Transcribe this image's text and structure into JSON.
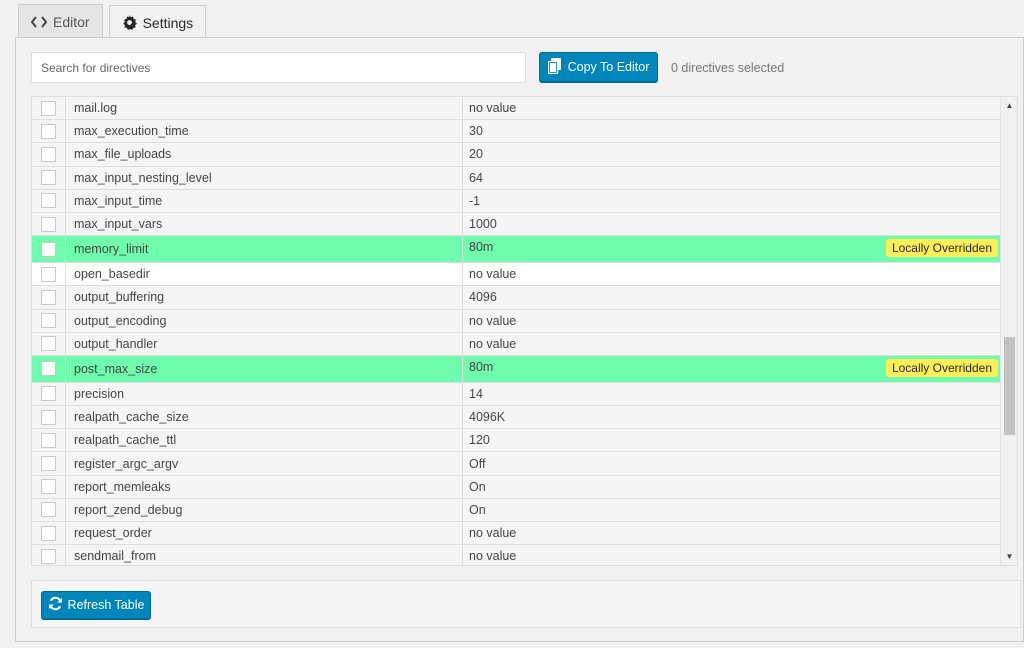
{
  "tabs": [
    {
      "label": "Editor",
      "icon": "code-icon"
    },
    {
      "label": "Settings",
      "icon": "gear-icon"
    }
  ],
  "search": {
    "placeholder": "Search for directives"
  },
  "copy_button": {
    "label": "Copy To Editor",
    "icon": "copy-icon"
  },
  "selected_count": "0 directives selected",
  "override_badge": "Locally Overridden",
  "colors": {
    "accent": "#0085ba",
    "override_row": "#6ffcac",
    "badge": "#ffee58"
  },
  "rows": [
    {
      "name": "mail.log",
      "value": "no value",
      "state": "normal"
    },
    {
      "name": "max_execution_time",
      "value": "30",
      "state": "normal"
    },
    {
      "name": "max_file_uploads",
      "value": "20",
      "state": "normal"
    },
    {
      "name": "max_input_nesting_level",
      "value": "64",
      "state": "normal"
    },
    {
      "name": "max_input_time",
      "value": "-1",
      "state": "normal"
    },
    {
      "name": "max_input_vars",
      "value": "1000",
      "state": "normal"
    },
    {
      "name": "memory_limit",
      "value": "80m",
      "state": "override"
    },
    {
      "name": "open_basedir",
      "value": "no value",
      "state": "white"
    },
    {
      "name": "output_buffering",
      "value": "4096",
      "state": "normal"
    },
    {
      "name": "output_encoding",
      "value": "no value",
      "state": "normal"
    },
    {
      "name": "output_handler",
      "value": "no value",
      "state": "normal"
    },
    {
      "name": "post_max_size",
      "value": "80m",
      "state": "override"
    },
    {
      "name": "precision",
      "value": "14",
      "state": "normal"
    },
    {
      "name": "realpath_cache_size",
      "value": "4096K",
      "state": "normal"
    },
    {
      "name": "realpath_cache_ttl",
      "value": "120",
      "state": "normal"
    },
    {
      "name": "register_argc_argv",
      "value": "Off",
      "state": "normal"
    },
    {
      "name": "report_memleaks",
      "value": "On",
      "state": "normal"
    },
    {
      "name": "report_zend_debug",
      "value": "On",
      "state": "normal"
    },
    {
      "name": "request_order",
      "value": "no value",
      "state": "normal"
    },
    {
      "name": "sendmail_from",
      "value": "no value",
      "state": "normal"
    }
  ],
  "refresh_button": {
    "label": "Refresh Table",
    "icon": "refresh-icon"
  }
}
